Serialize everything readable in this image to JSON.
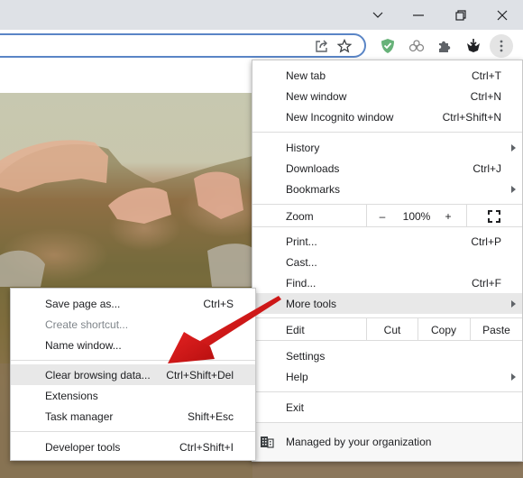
{
  "window_controls": {
    "tab_search": "chevron-down",
    "minimize": "minimize",
    "restore": "restore",
    "close": "close"
  },
  "toolbar": {
    "omnibox_value": "",
    "share_icon": "share-icon",
    "bookmark_icon": "star-icon",
    "extensions": [
      "shield-check-extension",
      "link-gears-extension",
      "puzzle-extensions",
      "download-mask-extension"
    ],
    "menu_icon": "kebab-menu-icon"
  },
  "main_menu": {
    "groups": [
      [
        {
          "label": "New tab",
          "shortcut": "Ctrl+T"
        },
        {
          "label": "New window",
          "shortcut": "Ctrl+N"
        },
        {
          "label": "New Incognito window",
          "shortcut": "Ctrl+Shift+N"
        }
      ],
      [
        {
          "label": "History",
          "shortcut": "",
          "submenu": true
        },
        {
          "label": "Downloads",
          "shortcut": "Ctrl+J"
        },
        {
          "label": "Bookmarks",
          "shortcut": "",
          "submenu": true
        }
      ]
    ],
    "zoom": {
      "label": "Zoom",
      "minus": "–",
      "value": "100%",
      "plus": "+",
      "fullscreen_icon": "fullscreen-icon"
    },
    "group3": [
      {
        "label": "Print...",
        "shortcut": "Ctrl+P"
      },
      {
        "label": "Cast...",
        "shortcut": ""
      },
      {
        "label": "Find...",
        "shortcut": "Ctrl+F"
      },
      {
        "label": "More tools",
        "shortcut": "",
        "submenu": true,
        "highlighted": true
      }
    ],
    "edit": {
      "label": "Edit",
      "cut": "Cut",
      "copy": "Copy",
      "paste": "Paste"
    },
    "group4": [
      {
        "label": "Settings",
        "shortcut": ""
      },
      {
        "label": "Help",
        "shortcut": "",
        "submenu": true
      }
    ],
    "exit": "Exit",
    "managed": "Managed by your organization"
  },
  "more_tools_submenu": {
    "items": [
      {
        "label": "Save page as...",
        "shortcut": "Ctrl+S"
      },
      {
        "label": "Create shortcut...",
        "shortcut": "",
        "disabled": true
      },
      {
        "label": "Name window...",
        "shortcut": ""
      },
      {
        "label": "Clear browsing data...",
        "shortcut": "Ctrl+Shift+Del",
        "highlighted": true
      },
      {
        "label": "Extensions",
        "shortcut": ""
      },
      {
        "label": "Task manager",
        "shortcut": "Shift+Esc"
      },
      {
        "label": "Developer tools",
        "shortcut": "Ctrl+Shift+I"
      }
    ]
  },
  "annotation": {
    "type": "arrow",
    "color": "#d71a1a",
    "points_to": "Clear browsing data..."
  }
}
